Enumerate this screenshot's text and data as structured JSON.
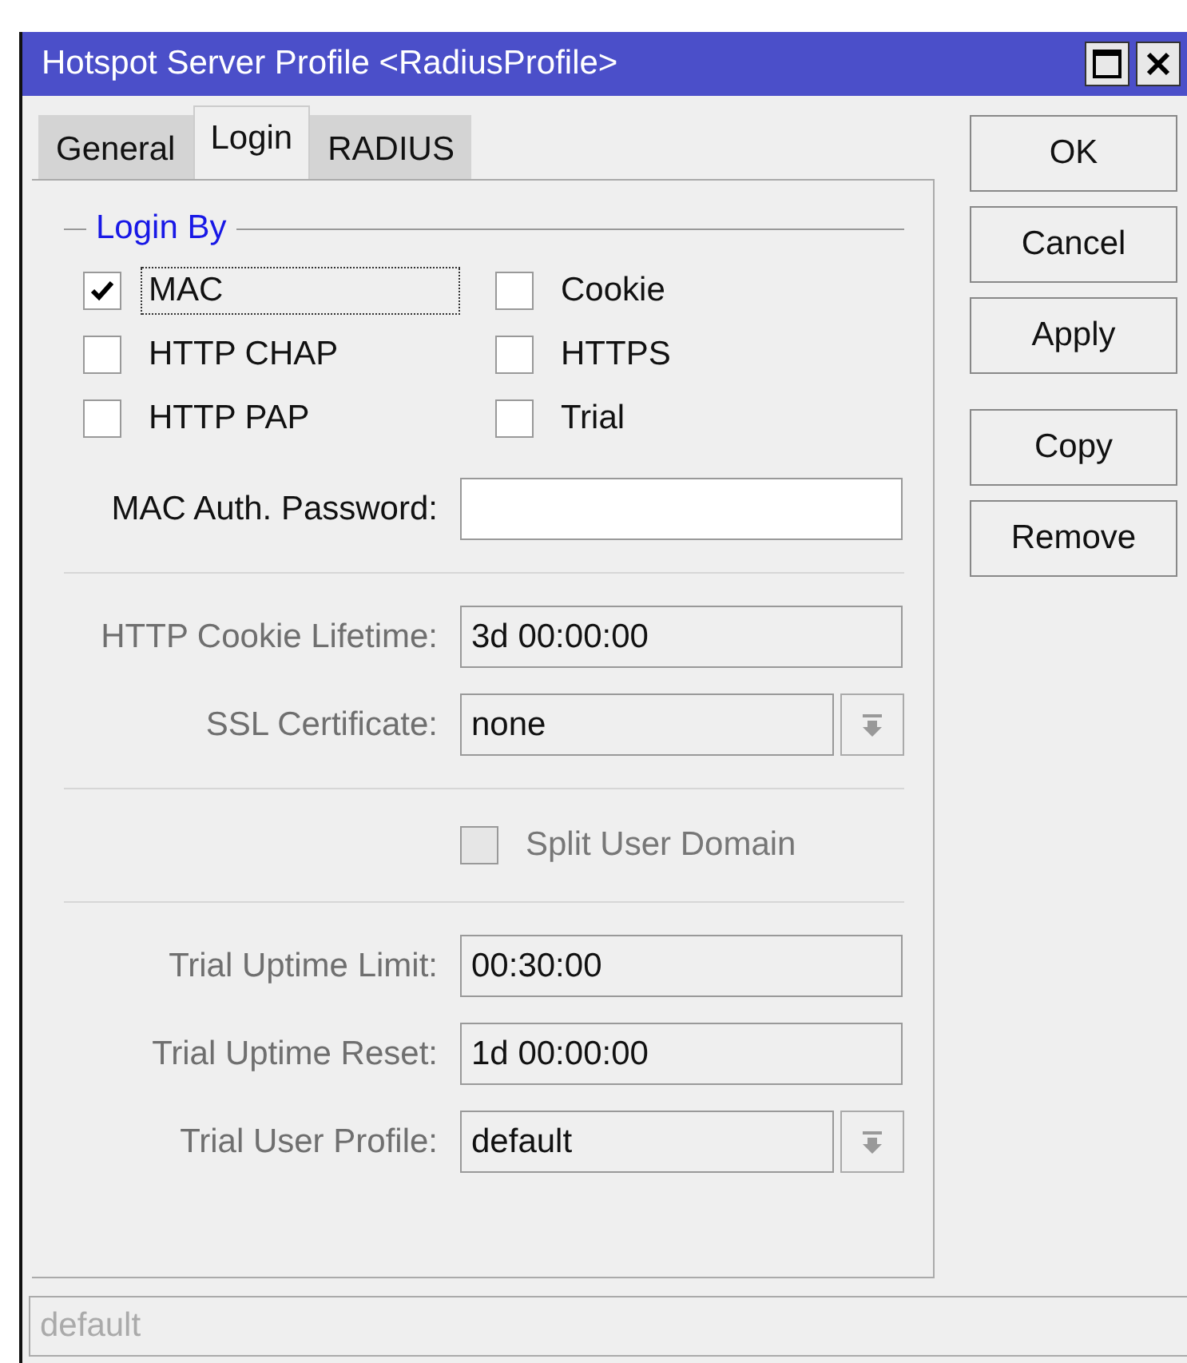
{
  "window": {
    "title": "Hotspot Server Profile <RadiusProfile>"
  },
  "tabs": [
    {
      "label": "General",
      "selected": false
    },
    {
      "label": "Login",
      "selected": true
    },
    {
      "label": "RADIUS",
      "selected": false
    }
  ],
  "login_by": {
    "title": "Login By",
    "options": [
      {
        "label": "MAC",
        "checked": true,
        "focused": true
      },
      {
        "label": "Cookie",
        "checked": false,
        "focused": false
      },
      {
        "label": "HTTP CHAP",
        "checked": false,
        "focused": false
      },
      {
        "label": "HTTPS",
        "checked": false,
        "focused": false
      },
      {
        "label": "HTTP PAP",
        "checked": false,
        "focused": false
      },
      {
        "label": "Trial",
        "checked": false,
        "focused": false
      }
    ]
  },
  "sections": [
    [
      {
        "kind": "text",
        "label": "MAC Auth. Password:",
        "disabled": false
      }
    ],
    [
      {
        "kind": "text",
        "label": "HTTP Cookie Lifetime:",
        "value": "3d 00:00:00",
        "disabled": true
      },
      {
        "kind": "select",
        "label": "SSL Certificate:",
        "value": "none",
        "disabled": true
      }
    ],
    [
      {
        "kind": "checkbox",
        "label": "Split User Domain",
        "checked": false,
        "disabled": true
      }
    ],
    [
      {
        "kind": "text",
        "label": "Trial Uptime Limit:",
        "value": "00:30:00",
        "disabled": true
      },
      {
        "kind": "text",
        "label": "Trial Uptime Reset:",
        "value": "1d 00:00:00",
        "disabled": true
      },
      {
        "kind": "select",
        "label": "Trial User Profile:",
        "value": "default",
        "disabled": true
      }
    ]
  ],
  "buttons": [
    [
      "OK",
      "Cancel",
      "Apply"
    ],
    [
      "Copy",
      "Remove"
    ]
  ],
  "status_bar": "default"
}
